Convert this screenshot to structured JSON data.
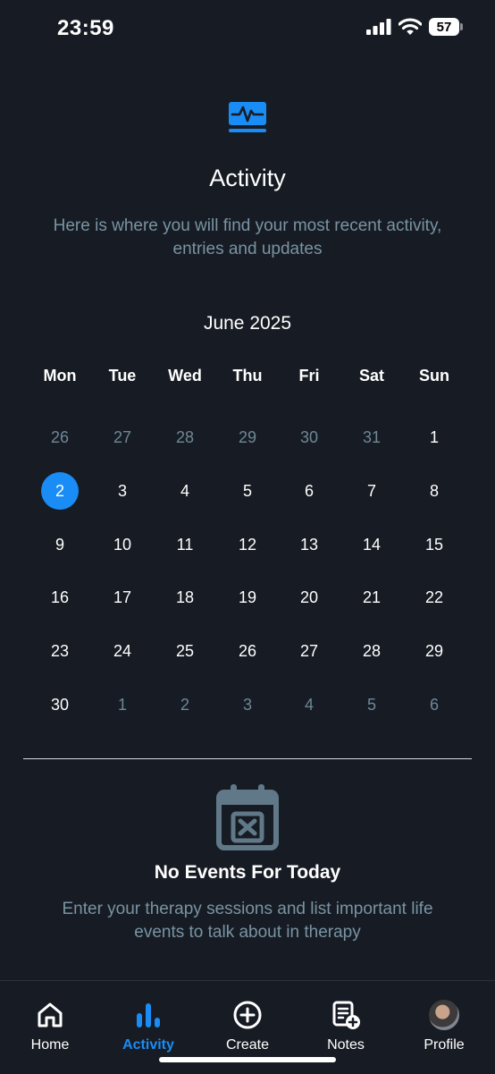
{
  "status": {
    "time": "23:59",
    "battery": "57"
  },
  "header": {
    "icon": "activity-pulse-icon",
    "title": "Activity",
    "subtitle": "Here is where you will find your most recent activity, entries and updates"
  },
  "calendar": {
    "month_label": "June 2025",
    "weekdays": [
      "Mon",
      "Tue",
      "Wed",
      "Thu",
      "Fri",
      "Sat",
      "Sun"
    ],
    "weeks": [
      [
        {
          "d": "26",
          "m": true
        },
        {
          "d": "27",
          "m": true
        },
        {
          "d": "28",
          "m": true
        },
        {
          "d": "29",
          "m": true
        },
        {
          "d": "30",
          "m": true
        },
        {
          "d": "31",
          "m": true
        },
        {
          "d": "1",
          "m": false
        }
      ],
      [
        {
          "d": "2",
          "m": false,
          "sel": true
        },
        {
          "d": "3",
          "m": false
        },
        {
          "d": "4",
          "m": false
        },
        {
          "d": "5",
          "m": false
        },
        {
          "d": "6",
          "m": false
        },
        {
          "d": "7",
          "m": false
        },
        {
          "d": "8",
          "m": false
        }
      ],
      [
        {
          "d": "9",
          "m": false
        },
        {
          "d": "10",
          "m": false
        },
        {
          "d": "11",
          "m": false
        },
        {
          "d": "12",
          "m": false
        },
        {
          "d": "13",
          "m": false
        },
        {
          "d": "14",
          "m": false
        },
        {
          "d": "15",
          "m": false
        }
      ],
      [
        {
          "d": "16",
          "m": false
        },
        {
          "d": "17",
          "m": false
        },
        {
          "d": "18",
          "m": false
        },
        {
          "d": "19",
          "m": false
        },
        {
          "d": "20",
          "m": false
        },
        {
          "d": "21",
          "m": false
        },
        {
          "d": "22",
          "m": false
        }
      ],
      [
        {
          "d": "23",
          "m": false
        },
        {
          "d": "24",
          "m": false
        },
        {
          "d": "25",
          "m": false
        },
        {
          "d": "26",
          "m": false
        },
        {
          "d": "27",
          "m": false
        },
        {
          "d": "28",
          "m": false
        },
        {
          "d": "29",
          "m": false
        }
      ],
      [
        {
          "d": "30",
          "m": false
        },
        {
          "d": "1",
          "m": true
        },
        {
          "d": "2",
          "m": true
        },
        {
          "d": "3",
          "m": true
        },
        {
          "d": "4",
          "m": true
        },
        {
          "d": "5",
          "m": true
        },
        {
          "d": "6",
          "m": true
        }
      ]
    ]
  },
  "empty_state": {
    "icon": "calendar-x-icon",
    "title": "No Events For Today",
    "subtitle": "Enter your therapy sessions and list important life events to talk about in therapy"
  },
  "tabs": [
    {
      "label": "Home",
      "icon": "home-icon",
      "active": false
    },
    {
      "label": "Activity",
      "icon": "bar-chart-icon",
      "active": true
    },
    {
      "label": "Create",
      "icon": "plus-circle-icon",
      "active": false
    },
    {
      "label": "Notes",
      "icon": "notes-add-icon",
      "active": false
    },
    {
      "label": "Profile",
      "icon": "avatar",
      "active": false
    }
  ],
  "colors": {
    "background": "#171c24",
    "accent": "#1a8cf5",
    "muted": "#7993a3"
  }
}
